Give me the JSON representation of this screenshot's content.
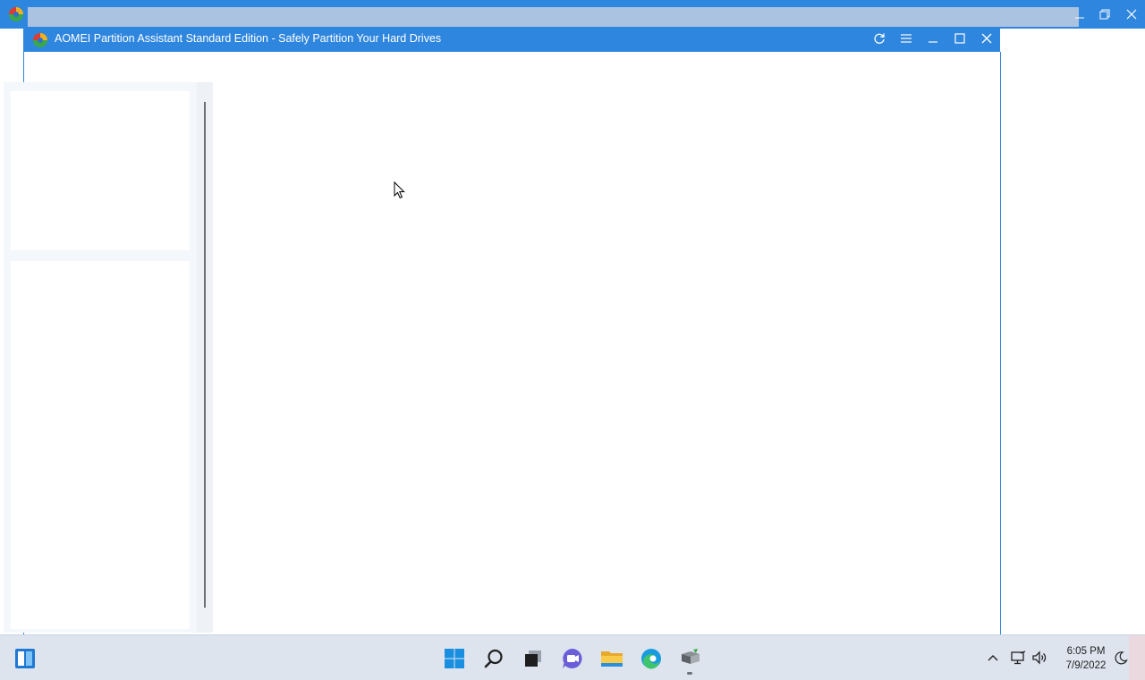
{
  "outer_window": {
    "title": "",
    "controls": [
      "minimize",
      "restore",
      "close"
    ]
  },
  "app_window": {
    "title": "AOMEI Partition Assistant Standard Edition - Safely Partition Your Hard Drives",
    "controls": [
      "refresh",
      "menu",
      "minimize",
      "maximize",
      "close"
    ]
  },
  "colors": {
    "titlebar": "#2f86de",
    "taskbar": "#dde4ee"
  },
  "taskbar": {
    "widgets_icon": "widgets-icon",
    "apps": [
      "start",
      "search",
      "task-view",
      "chat",
      "file-explorer",
      "edge",
      "aomei-partition-assistant"
    ]
  },
  "tray": {
    "icons": [
      "chevron-up",
      "network",
      "volume",
      "focus-assist"
    ],
    "time": "6:05 PM",
    "date": "7/9/2022"
  }
}
